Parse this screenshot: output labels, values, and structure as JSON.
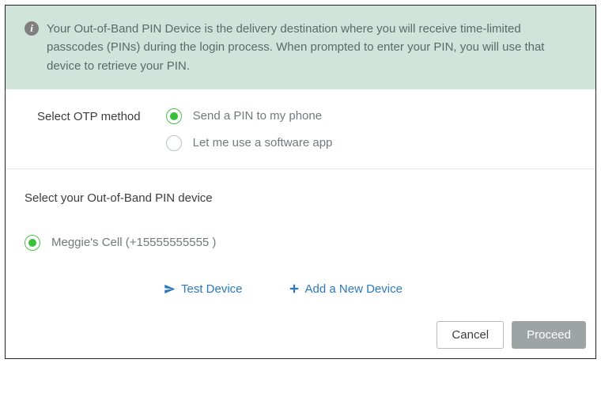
{
  "info": {
    "text": "Your Out-of-Band PIN Device is the delivery destination where you will receive time-limited passcodes (PINs) during the login process. When prompted to enter your PIN, you will use that device to retrieve your PIN."
  },
  "otp": {
    "label": "Select OTP method",
    "options": [
      {
        "label": "Send a PIN to my phone",
        "selected": true
      },
      {
        "label": "Let me use a software app",
        "selected": false
      }
    ]
  },
  "device": {
    "heading": "Select your Out-of-Band PIN device",
    "items": [
      {
        "label": "Meggie's Cell (+15555555555 )",
        "selected": true
      }
    ]
  },
  "actions": {
    "test": "Test Device",
    "add": "Add a New Device"
  },
  "buttons": {
    "cancel": "Cancel",
    "proceed": "Proceed"
  }
}
